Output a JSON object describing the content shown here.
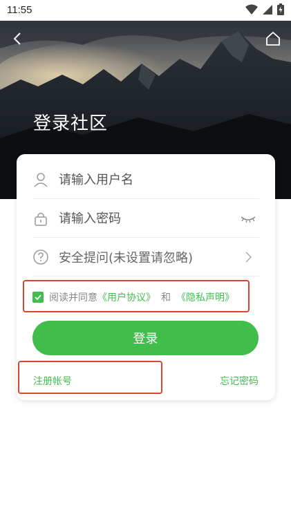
{
  "status_bar": {
    "time": "11:55",
    "icons": [
      "wifi-icon",
      "signal-icon",
      "battery-icon"
    ]
  },
  "header": {
    "title": "登录社区",
    "back_icon": "back-arrow-icon",
    "home_icon": "home-icon"
  },
  "form": {
    "username_placeholder": "请输入用户名",
    "password_placeholder": "请输入密码",
    "security_question_label": "安全提问(未设置请忽略)",
    "agreement": {
      "prefix": "阅读并同意",
      "user_agreement": "《用户协议》",
      "and": "和",
      "privacy": "《隐私声明》",
      "checked": true
    },
    "login_button": "登录",
    "register_link": "注册帐号",
    "forgot_link": "忘记密码"
  },
  "colors": {
    "accent": "#42bd4b",
    "highlight": "#d4472e"
  }
}
